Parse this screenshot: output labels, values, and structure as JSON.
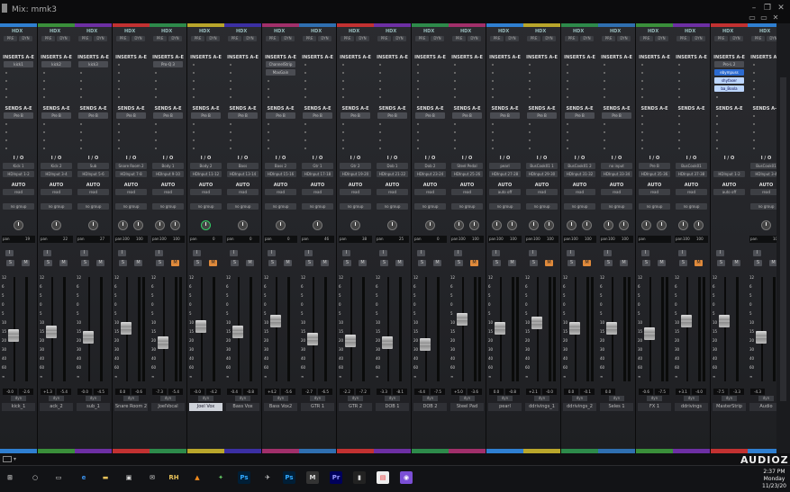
{
  "window": {
    "title": "Mix: mmk3",
    "controls": [
      "–",
      "❐",
      "✕"
    ],
    "sub_controls": [
      "▭",
      "▭",
      "✕"
    ]
  },
  "labels": {
    "hdx": "HDX",
    "pre_button": "PRE",
    "dyn_button": "DYN",
    "inserts": "INSERTS A-E",
    "sends": "SENDS A-E",
    "io": "I / O",
    "auto_section": "AUTO",
    "pan": "pan",
    "input_button": "I",
    "solo": "S",
    "mute": "M",
    "dyn": "dyn"
  },
  "scale_marks": [
    "12",
    "6",
    "5",
    "0",
    "5",
    "10",
    "15",
    "20",
    "30",
    "40",
    "60",
    "∞"
  ],
  "strips": [
    {
      "name": "kick_1",
      "color": "#2f7fd1",
      "inserts": [
        "kick1"
      ],
      "sends": [
        "Pre B"
      ],
      "input": "Kick 1",
      "output": "HDInput 1-2",
      "auto": "read",
      "group": "no group",
      "knobs": 1,
      "pan": "19",
      "pan2": "",
      "stereo": false,
      "mute_on": false,
      "level1": "-0.0",
      "level2": "-2.6",
      "fader": 0.42
    },
    {
      "name": "ack_2",
      "color": "#3a8f3a",
      "inserts": [
        "kick2"
      ],
      "sends": [
        "Pre B"
      ],
      "input": "Kick 2",
      "output": "HDInput 3-4",
      "auto": "read",
      "group": "no group",
      "knobs": 1,
      "pan": "22",
      "pan2": "",
      "stereo": false,
      "mute_on": false,
      "level1": "+1.3",
      "level2": "-5.4",
      "fader": 0.46
    },
    {
      "name": "sub_1",
      "color": "#6d2fa3",
      "inserts": [
        "kick3"
      ],
      "sends": [
        "Pre B"
      ],
      "input": "Sub",
      "output": "HDInput 5-6",
      "auto": "read",
      "group": "no group",
      "knobs": 1,
      "pan": "27",
      "pan2": "",
      "stereo": false,
      "mute_on": false,
      "level1": "-0.0",
      "level2": "-4.5",
      "fader": 0.4
    },
    {
      "name": "Snare Room 2",
      "color": "#c23131",
      "inserts": [],
      "sends": [
        "Pre B"
      ],
      "input": "Snare Room 2",
      "output": "HDInput 7-8",
      "auto": "read",
      "group": "no group",
      "knobs": 2,
      "pan": "100",
      "pan2": "100",
      "stereo": true,
      "mute_on": false,
      "level1": "0.0",
      "level2": "-0.6",
      "fader": 0.5
    },
    {
      "name": "JoelVocal",
      "color": "#2d8a4a",
      "inserts": [
        "Pro-Q 3"
      ],
      "sends": [
        "Pre B"
      ],
      "input": "Body 1",
      "output": "HDInput 9-10",
      "auto": "read",
      "group": "no group",
      "knobs": 2,
      "pan": "100",
      "pan2": "100",
      "stereo": true,
      "mute_on": true,
      "level1": "-7.3",
      "level2": "-5.4",
      "fader": 0.34
    },
    {
      "name": "Joel Vox",
      "color": "#b9a62b",
      "inserts": [],
      "sends": [
        "Pre B"
      ],
      "input": "Body 2",
      "output": "HDInput 11-12",
      "auto": "read",
      "group": "no group",
      "knobs": 1,
      "pan": "0",
      "pan2": "",
      "stereo": false,
      "mute_on": true,
      "level1": "-0.0",
      "level2": "-4.2",
      "fader": 0.52,
      "selected": true
    },
    {
      "name": "Bass Vox",
      "color": "#3b2fa3",
      "inserts": [],
      "sends": [
        "Pre B"
      ],
      "input": "Bass",
      "output": "HDInput 13-14",
      "auto": "read",
      "group": "no group",
      "knobs": 1,
      "pan": "0",
      "pan2": "",
      "stereo": false,
      "mute_on": false,
      "level1": "-0.4",
      "level2": "-0.8",
      "fader": 0.46
    },
    {
      "name": "Bass Vox2",
      "color": "#a12f6a",
      "inserts": [
        "ChannelStrip",
        "MaxGain"
      ],
      "sends": [
        "Pre B"
      ],
      "input": "Bass 2",
      "output": "HDInput 15-16",
      "auto": "read",
      "group": "no group",
      "knobs": 1,
      "pan": "0",
      "pan2": "",
      "stereo": false,
      "mute_on": false,
      "level1": "+4.2",
      "level2": "-5.6",
      "fader": 0.58
    },
    {
      "name": "GTR 1",
      "color": "#2f6fb0",
      "inserts": [],
      "sends": [
        "Pre B"
      ],
      "input": "Gtr 1",
      "output": "HDInput 17-18",
      "auto": "read",
      "group": "no group",
      "knobs": 1,
      "pan": "46",
      "pan2": "",
      "stereo": false,
      "mute_on": false,
      "level1": "-2.7",
      "level2": "-6.5",
      "fader": 0.38
    },
    {
      "name": "GTR 2",
      "color": "#c23131",
      "inserts": [],
      "sends": [
        "Pre B"
      ],
      "input": "Gtr 2",
      "output": "HDInput 19-20",
      "auto": "read",
      "group": "no group",
      "knobs": 1,
      "pan": "38",
      "pan2": "",
      "stereo": false,
      "mute_on": false,
      "level1": "-2.2",
      "level2": "-7.2",
      "fader": 0.36
    },
    {
      "name": "DOB 1",
      "color": "#6d2fa3",
      "inserts": [],
      "sends": [
        "Pre B"
      ],
      "input": "Dob 1",
      "output": "HDInput 21-22",
      "auto": "read",
      "group": "no group",
      "knobs": 1,
      "pan": "25",
      "pan2": "",
      "stereo": false,
      "mute_on": false,
      "level1": "-3.3",
      "level2": "-8.1",
      "fader": 0.34
    },
    {
      "name": "DOB 2",
      "color": "#2d8a4a",
      "inserts": [],
      "sends": [
        "Pre B"
      ],
      "input": "Dob 2",
      "output": "HDInput 23-24",
      "auto": "read",
      "group": "no group",
      "knobs": 1,
      "pan": "0",
      "pan2": "",
      "stereo": false,
      "mute_on": false,
      "level1": "-4.4",
      "level2": "-7.5",
      "fader": 0.32
    },
    {
      "name": "Steel Pad",
      "color": "#a12f6a",
      "inserts": [],
      "sends": [
        "Pre B"
      ],
      "input": "Steel Pedal",
      "output": "HDInput 25-26",
      "auto": "read",
      "group": "no group",
      "knobs": 2,
      "pan": "100",
      "pan2": "100",
      "stereo": true,
      "mute_on": true,
      "level1": "+5.0",
      "level2": "-3.6",
      "fader": 0.6
    },
    {
      "name": "pearl",
      "color": "#2f7fd1",
      "inserts": [],
      "sends": [
        "Pre B"
      ],
      "input": "pearl",
      "output": "HDInput 27-28",
      "auto": "auto off",
      "group": "no group",
      "knobs": 2,
      "pan": "100",
      "pan2": "100",
      "stereo": true,
      "mute_on": false,
      "level1": "0.0",
      "level2": "-0.8",
      "fader": 0.5
    },
    {
      "name": "ddrivings_1",
      "color": "#b9a62b",
      "inserts": [],
      "sends": [
        "Pre B"
      ],
      "input": "BusCook01 1",
      "output": "HDInput 29-30",
      "auto": "read",
      "group": "no group",
      "knobs": 2,
      "pan": "100",
      "pan2": "100",
      "stereo": true,
      "mute_on": true,
      "level1": "+2.1",
      "level2": "-0.0",
      "fader": 0.56
    },
    {
      "name": "ddrivings_2",
      "color": "#2d8a4a",
      "inserts": [],
      "sends": [
        "Pre B"
      ],
      "input": "BusCook01 2",
      "output": "HDInput 31-32",
      "auto": "read",
      "group": "no group",
      "knobs": 2,
      "pan": "100",
      "pan2": "100",
      "stereo": true,
      "mute_on": true,
      "level1": "0.0",
      "level2": "-0.1",
      "fader": 0.5
    },
    {
      "name": "Seles 1",
      "color": "#2f6fb0",
      "inserts": [],
      "sends": [
        "Pre B"
      ],
      "input": "no input",
      "output": "HDInput 33-34",
      "auto": "read",
      "group": "no group",
      "knobs": 2,
      "pan": "100",
      "pan2": "100",
      "stereo": true,
      "mute_on": false,
      "level1": "0.0",
      "level2": "",
      "fader": 0.5
    },
    {
      "name": "FX 1",
      "color": "#3a8f3a",
      "inserts": [],
      "sends": [],
      "input": "Pre B",
      "output": "HDInput 35-36",
      "auto": "read",
      "group": "no group",
      "knobs": 2,
      "pan": "",
      "pan2": "",
      "stereo": true,
      "mute_on": false,
      "level1": "-0.6",
      "level2": "-7.5",
      "fader": 0.44
    },
    {
      "name": "ddrivings",
      "color": "#6d2fa3",
      "inserts": [],
      "sends": [],
      "input": "BusCook01",
      "output": "HDInput 37-38",
      "auto": "read",
      "group": "no group",
      "knobs": 2,
      "pan": "100",
      "pan2": "100",
      "stereo": true,
      "mute_on": true,
      "level1": "+3.1",
      "level2": "-4.0",
      "fader": 0.58
    },
    {
      "name": "MasterStrip",
      "color": "#c23131",
      "inserts": [
        "Pro-L 2",
        "ebympuss",
        "shyfaser",
        "ba_Boola"
      ],
      "sends": [],
      "input": "",
      "output": "HDInput 1-2",
      "auto": "auto off",
      "group": "",
      "knobs": 0,
      "pan": "",
      "pan2": "",
      "stereo": false,
      "mute_on": false,
      "level1": "-7.5",
      "level2": "-3.3",
      "fader": 0.58,
      "master": true
    },
    {
      "name": "Audio",
      "color": "#2f7fd1",
      "inserts": [],
      "sends": [],
      "input": "BusCook01",
      "output": "HDInput 3-4",
      "auto": "read",
      "group": "no group",
      "knobs": 1,
      "pan": "100",
      "pan2": "",
      "stereo": false,
      "mute_on": false,
      "level1": "-4.3",
      "level2": "",
      "fader": 0.4
    }
  ],
  "taskbar": {
    "items": [
      {
        "name": "windows-icon",
        "label": "⊞",
        "color": "#ccc",
        "bg": "transparent"
      },
      {
        "name": "search-icon",
        "label": "○",
        "color": "#ddd",
        "bg": "transparent"
      },
      {
        "name": "taskview-icon",
        "label": "▭",
        "color": "#ddd",
        "bg": "transparent"
      },
      {
        "name": "edge-icon",
        "label": "e",
        "color": "#3a8ee6",
        "bg": "transparent"
      },
      {
        "name": "explorer-icon",
        "label": "▬",
        "color": "#e8c25a",
        "bg": "transparent"
      },
      {
        "name": "store-icon",
        "label": "▣",
        "color": "#ddd",
        "bg": "transparent"
      },
      {
        "name": "mail-icon",
        "label": "✉",
        "color": "#ddd",
        "bg": "transparent"
      },
      {
        "name": "rh-icon",
        "label": "RH",
        "color": "#e8c25a",
        "bg": "transparent"
      },
      {
        "name": "vlc-icon",
        "label": "▲",
        "color": "#f08a1c",
        "bg": "transparent"
      },
      {
        "name": "app-icon",
        "label": "✦",
        "color": "#6c6",
        "bg": "transparent"
      },
      {
        "name": "photoshop-icon",
        "label": "Ps",
        "color": "#31a8ff",
        "bg": "#001e36"
      },
      {
        "name": "tool-icon",
        "label": "✈",
        "color": "#ddd",
        "bg": "transparent"
      },
      {
        "name": "photoshop2-icon",
        "label": "Ps",
        "color": "#31a8ff",
        "bg": "#001e36"
      },
      {
        "name": "m-icon",
        "label": "M",
        "color": "#ddd",
        "bg": "#333"
      },
      {
        "name": "premiere-icon",
        "label": "Pr",
        "color": "#9999ff",
        "bg": "#00005b"
      },
      {
        "name": "monitor-icon",
        "label": "▮",
        "color": "#ddd",
        "bg": "#222"
      },
      {
        "name": "pdf-icon",
        "label": "▤",
        "color": "#e33",
        "bg": "#eee"
      },
      {
        "name": "protools-icon",
        "label": "◉",
        "color": "#fff",
        "bg": "#7b4fd6"
      }
    ],
    "time": "2:37 PM",
    "day": "Monday",
    "date": "11/23/20"
  },
  "watermark": "AUDIOZ"
}
